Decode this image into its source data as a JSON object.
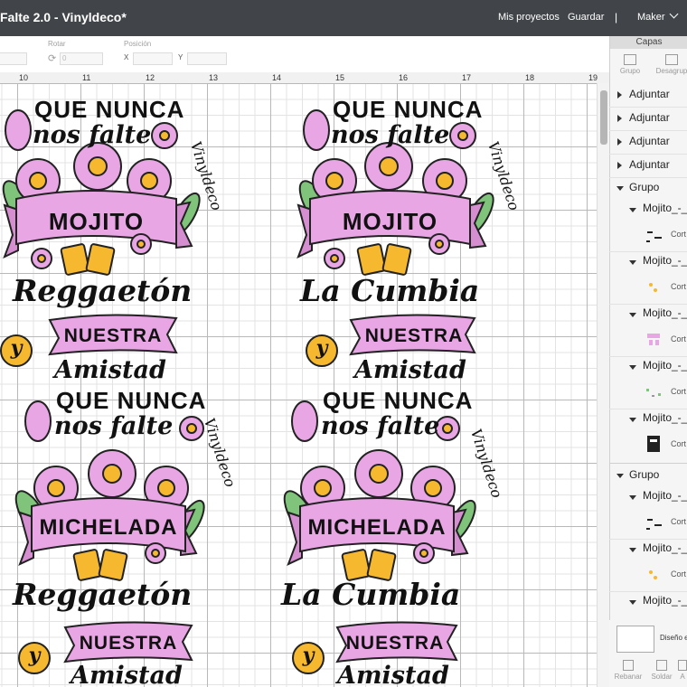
{
  "header": {
    "title": "Falte 2.0 - Vinyldeco*",
    "nav_projects": "Mis proyectos",
    "nav_save": "Guardar",
    "separator": "|",
    "nav_maker": "Maker"
  },
  "toolbar": {
    "rotate_label": "Rotar",
    "position_label": "Posición",
    "x_label": "X",
    "y_label": "Y",
    "rotate_value": "0"
  },
  "ruler": {
    "numbers": [
      "10",
      "11",
      "12",
      "13",
      "14",
      "15",
      "16",
      "17",
      "18",
      "19"
    ]
  },
  "designs": [
    {
      "line1": "QUE NUNCA",
      "line2": "nos falte",
      "banner": "MOJITO",
      "genre": "Reggaetón",
      "y": "y",
      "nuestra": "NUESTRA",
      "amistad": "Amistad",
      "brand": "Vinyldeco"
    },
    {
      "line1": "QUE NUNCA",
      "line2": "nos falte",
      "banner": "MOJITO",
      "genre": "La Cumbia",
      "y": "y",
      "nuestra": "NUESTRA",
      "amistad": "Amistad",
      "brand": "Vinyldeco"
    },
    {
      "line1": "QUE NUNCA",
      "line2": "nos falte",
      "banner": "MICHELADA",
      "genre": "Reggaetón",
      "y": "y",
      "nuestra": "NUESTRA",
      "amistad": "Amistad",
      "brand": "Vinyldeco"
    },
    {
      "line1": "QUE NUNCA",
      "line2": "nos falte",
      "banner": "MICHELADA",
      "genre": "La Cumbia",
      "y": "y",
      "nuestra": "NUESTRA",
      "amistad": "Amistad",
      "brand": "Vinyldeco"
    }
  ],
  "panel": {
    "title": "Capas",
    "group_btn": "Grupo",
    "ungroup_btn": "Desagrup",
    "layers": [
      {
        "label": "Adjuntar"
      },
      {
        "label": "Adjuntar"
      },
      {
        "label": "Adjuntar"
      },
      {
        "label": "Adjuntar"
      },
      {
        "label": "Grupo"
      },
      {
        "label": "Mojito_-_"
      },
      {
        "label": "Mojito_-_"
      },
      {
        "label": "Mojito_-_"
      },
      {
        "label": "Mojito_-_"
      },
      {
        "label": "Mojito_-_"
      },
      {
        "label": "Grupo"
      },
      {
        "label": "Mojito_-_"
      },
      {
        "label": "Mojito_-_"
      },
      {
        "label": "Mojito_-_"
      }
    ],
    "cort_label": "Cort",
    "design_label": "Diseño e",
    "bottom_buttons": [
      "Rebanar",
      "Soldar",
      "A"
    ]
  },
  "colors": {
    "titlebar": "#414549",
    "pink": "#e8a6e4",
    "pink_dark": "#d58ed0",
    "yellow": "#f5b82e",
    "leaf": "#7fc47a"
  }
}
